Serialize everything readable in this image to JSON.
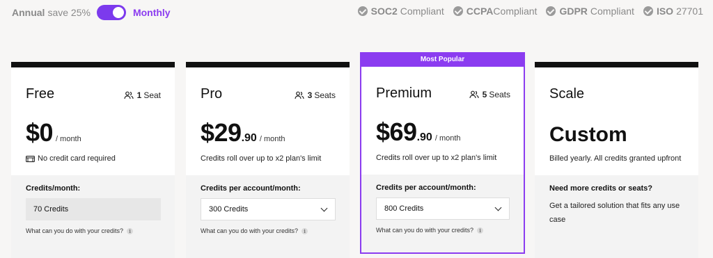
{
  "billing": {
    "annual_label": "Annual",
    "save_label": "save 25%",
    "monthly_label": "Monthly",
    "toggle_state": "monthly"
  },
  "compliance": [
    {
      "bold": "SOC2",
      "label": "Compliant"
    },
    {
      "bold": "CCPA",
      "label": "Compliant"
    },
    {
      "bold": "GDPR",
      "label": "Compliant"
    },
    {
      "bold": "ISO",
      "label": "27701"
    }
  ],
  "colors": {
    "accent": "#8b3cf0",
    "dark": "#111111"
  },
  "plans": [
    {
      "name": "Free",
      "seats_num": "1",
      "seats_label": "Seat",
      "price_main": "$0",
      "price_cents": "",
      "price_period": "/ month",
      "subtitle": "No credit card required",
      "credits_title": "Credits/month:",
      "credits_value": "70 Credits",
      "what_text": "What can you do with your credits?"
    },
    {
      "name": "Pro",
      "seats_num": "3",
      "seats_label": "Seats",
      "price_main": "$29",
      "price_cents": ".90",
      "price_period": "/ month",
      "subtitle": "Credits roll over up to x2 plan's limit",
      "credits_title": "Credits per account/month:",
      "credits_value": "300 Credits",
      "what_text": "What can you do with your credits?"
    },
    {
      "banner": "Most Popular",
      "name": "Premium",
      "seats_num": "5",
      "seats_label": "Seats",
      "price_main": "$69",
      "price_cents": ".90",
      "price_period": "/ month",
      "subtitle": "Credits roll over up to x2 plan's limit",
      "credits_title": "Credits per account/month:",
      "credits_value": "800 Credits",
      "what_text": "What can you do with your credits?"
    },
    {
      "name": "Scale",
      "price_main": "Custom",
      "subtitle": "Billed yearly. All credits granted upfront",
      "credits_title": "Need more credits or seats?",
      "description": "Get a tailored solution that fits any use case"
    }
  ],
  "info_glyph": "i"
}
